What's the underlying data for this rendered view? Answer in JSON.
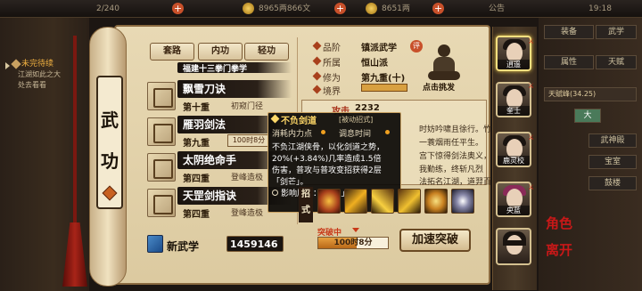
{
  "topbar": {
    "stamina": "2/240",
    "silver": "8965两866文",
    "gold": "8651两",
    "announce": "公告",
    "time": "19:18"
  },
  "left_panel": {
    "task_title": "未完待续",
    "task_line1": "江湖如此之大",
    "task_line2": "处去看看"
  },
  "scroll": {
    "side_char1": "武",
    "side_char2": "功",
    "tabs": [
      "套路",
      "内功",
      "轻功"
    ]
  },
  "skills": [
    {
      "name": "福建十三拳门拳学",
      "rank": "",
      "tag": ""
    },
    {
      "name": "飘雪刀诀",
      "rank": "第十重",
      "tag": "初窥门径"
    },
    {
      "name": "雁羽剑法",
      "rank": "第九重",
      "tag": "100时8分"
    },
    {
      "name": "太阴绝命手",
      "rank": "第四重",
      "tag": "登峰造极"
    },
    {
      "name": "天罡剑指诀",
      "rank": "第四重",
      "tag": "登峰造极"
    }
  ],
  "info": {
    "category_label": "品阶",
    "category_value": "镇派武学",
    "category_badge": "评",
    "sect_label": "所属",
    "sect_value": "恒山派",
    "cultivation_label": "修为",
    "cultivation_value": "第九重(十)",
    "realm_label": "境界",
    "figure_caption": "点击挑发",
    "attack_label": "攻击",
    "attack_value": "2232",
    "desc_line1": "时妨吟啸且徐行。竹",
    "desc_line2": "一蓑烟雨任平生。",
    "desc_line3": "宫下惊得剑法奥义，",
    "desc_line4": "我勤练，终斩凡烈",
    "desc_line5": "法拓名江湖，道羿百"
  },
  "tooltip": {
    "title": "不负剑道",
    "tag": "[被动招式]",
    "cost_label": "消耗内力点",
    "time_label": "调息时间",
    "body_line1": "不负江湖侠骨，以化剑道之势，",
    "body_line2": "20%(+3.84%)几率造成1.5倍",
    "body_line3": "伤害，普攻与普攻变招获得2层",
    "body_line4": "「剑芒」。",
    "attr_line": "影响属性：「内息」"
  },
  "moves": {
    "label": "招式",
    "count": 6
  },
  "bottom": {
    "new_wugong": "新武学",
    "count": "1459146",
    "breakthrough_label": "突破中",
    "breakthrough_time": "100时8分",
    "breakthrough_progress": 0.55,
    "accel_btn": "加速突破"
  },
  "portraits": [
    {
      "name": "逍遥",
      "active": true
    },
    {
      "name": "奎士",
      "active": false
    },
    {
      "name": "鹿灵校",
      "active": false
    },
    {
      "name": "央蓝",
      "active": false
    },
    {
      "name": "",
      "active": false
    }
  ],
  "right_menu": {
    "items": [
      "装备",
      "武学",
      "属性",
      "天赋",
      "大",
      "武神殿",
      "宝室",
      "鼓楼"
    ],
    "pin": "天赋峰(34.25)",
    "role_text1": "角色",
    "role_text2": "离开"
  }
}
